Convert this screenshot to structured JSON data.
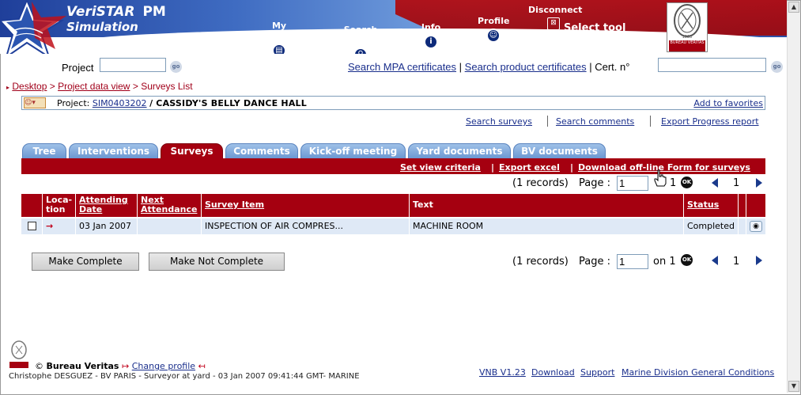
{
  "header": {
    "app_name": "VeriSTAR",
    "app_pm": "PM",
    "app_sub": "Simulation",
    "nav": {
      "my_desktop": "My desktop",
      "search_project": "Search project",
      "info": "Info",
      "profile": "Profile",
      "disconnect": "Disconnect",
      "select_tool": "Select tool"
    },
    "bv_logo_text": "BUREAU VERITAS",
    "bv_logo_year": "1828"
  },
  "project_search": {
    "label": "Project",
    "value": "",
    "go": "go",
    "links": {
      "mpa": "Search MPA certificates",
      "product": "Search product certificates",
      "cert_label": "Cert. n°"
    },
    "cert_value": ""
  },
  "breadcrumb": {
    "desktop": "Desktop",
    "project_data": "Project data view",
    "current": "Surveys List",
    "sep": ">"
  },
  "project": {
    "prefix": "Project:",
    "code": "SIM0403202",
    "name": "/ CASSIDY'S BELLY DANCE HALL",
    "add_favorites": "Add to favorites"
  },
  "sublinks": {
    "search_surveys": "Search surveys",
    "search_comments": "Search comments",
    "export_progress": "Export Progress report"
  },
  "tabs": [
    {
      "label": "Tree"
    },
    {
      "label": "Interventions"
    },
    {
      "label": "Surveys"
    },
    {
      "label": "Comments"
    },
    {
      "label": "Kick-off meeting"
    },
    {
      "label": "Yard documents"
    },
    {
      "label": "BV documents"
    }
  ],
  "actions": {
    "set_view": "Set view criteria",
    "export_excel": "Export excel",
    "download_form": "Download off-line Form for surveys",
    "pipe": "|"
  },
  "pager_top": {
    "records": "(1 records)",
    "page_label": "Page :",
    "page_value": "1",
    "total": "1",
    "ok": "OK",
    "current": "1"
  },
  "table": {
    "headers": {
      "location": "Loca-tion",
      "attending": "Attending Date",
      "next": "Next Attendance",
      "survey_item": "Survey Item",
      "text": "Text",
      "status": "Status"
    },
    "rows": [
      {
        "location_icon": "→",
        "attending": "03 Jan 2007",
        "next": "",
        "survey_item": "INSPECTION OF AIR COMPRES...",
        "text": "MACHINE ROOM",
        "status": "Completed",
        "view_icon": "◉"
      }
    ]
  },
  "buttons": {
    "make_complete": "Make Complete",
    "make_not_complete": "Make Not Complete"
  },
  "pager_bottom": {
    "records": "(1 records)",
    "page_label": "Page :",
    "page_value": "1",
    "on": "on 1",
    "ok": "OK",
    "current": "1"
  },
  "footer": {
    "copyright": "©",
    "company": "Bureau Veritas",
    "change_profile": "Change profile",
    "user_line": "Christophe DESGUEZ - BV PARIS - Surveyor at yard - 03 Jan 2007 09:41:44 GMT- MARINE",
    "version": "VNB V1.23",
    "download": "Download",
    "support": "Support",
    "conditions": "Marine Division General Conditions"
  },
  "colors": {
    "brand_red": "#a50010",
    "link_blue": "#1a2f8c",
    "tab_blue": "#6c98d2",
    "row_bg": "#dfe9f6"
  }
}
